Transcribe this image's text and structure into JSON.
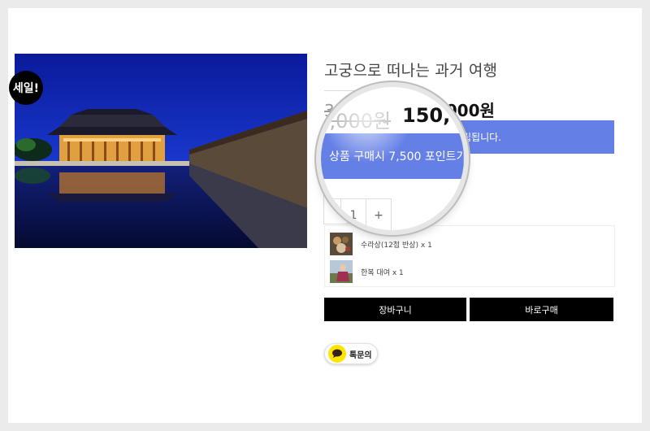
{
  "product": {
    "title": "고궁으로 떠나는 과거 여행",
    "sale_badge": "세일!",
    "image_icon": "palace-night-photo",
    "price_original": "30,000원",
    "price_sale": "150,000원",
    "points_text": "상품 구매시 7,500 포인트가 적립됩니다.",
    "points_partial": "적립됩니다.",
    "quantity": "1",
    "qty_minus": "-",
    "qty_plus": "+"
  },
  "magnifier": {
    "price_original": "30,000원",
    "price_sale": "150,",
    "points_text": "상품 구매시 7,500 포인트가",
    "quantity": "1",
    "qty_plus": "+"
  },
  "options": [
    {
      "label": "수라상(12첩 반상) x 1",
      "icon": "food-thumbnail"
    },
    {
      "label": "한복 대여 x 1",
      "icon": "hanbok-thumbnail"
    }
  ],
  "buttons": {
    "cart": "장바구니",
    "buy": "바로구매",
    "talk": "톡문의"
  },
  "colors": {
    "points_bar": "#6480e6",
    "kakao_yellow": "#fee500"
  }
}
